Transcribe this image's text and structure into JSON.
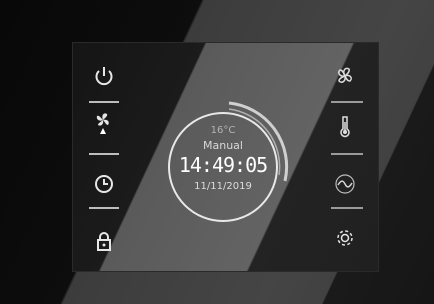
{
  "display": {
    "temperature": "16°C",
    "mode": "Manual",
    "time": "14:49:05",
    "date": "11/11/2019"
  },
  "left_icons": [
    "power-icon",
    "fan-speed-icon",
    "clock-icon",
    "lock-icon"
  ],
  "right_icons": [
    "fan-icon",
    "thermometer-icon",
    "wave-icon",
    "settings-gear-icon"
  ],
  "colors": {
    "icon_stroke": "#e6e6e6",
    "ring": "#e8e8e8"
  }
}
